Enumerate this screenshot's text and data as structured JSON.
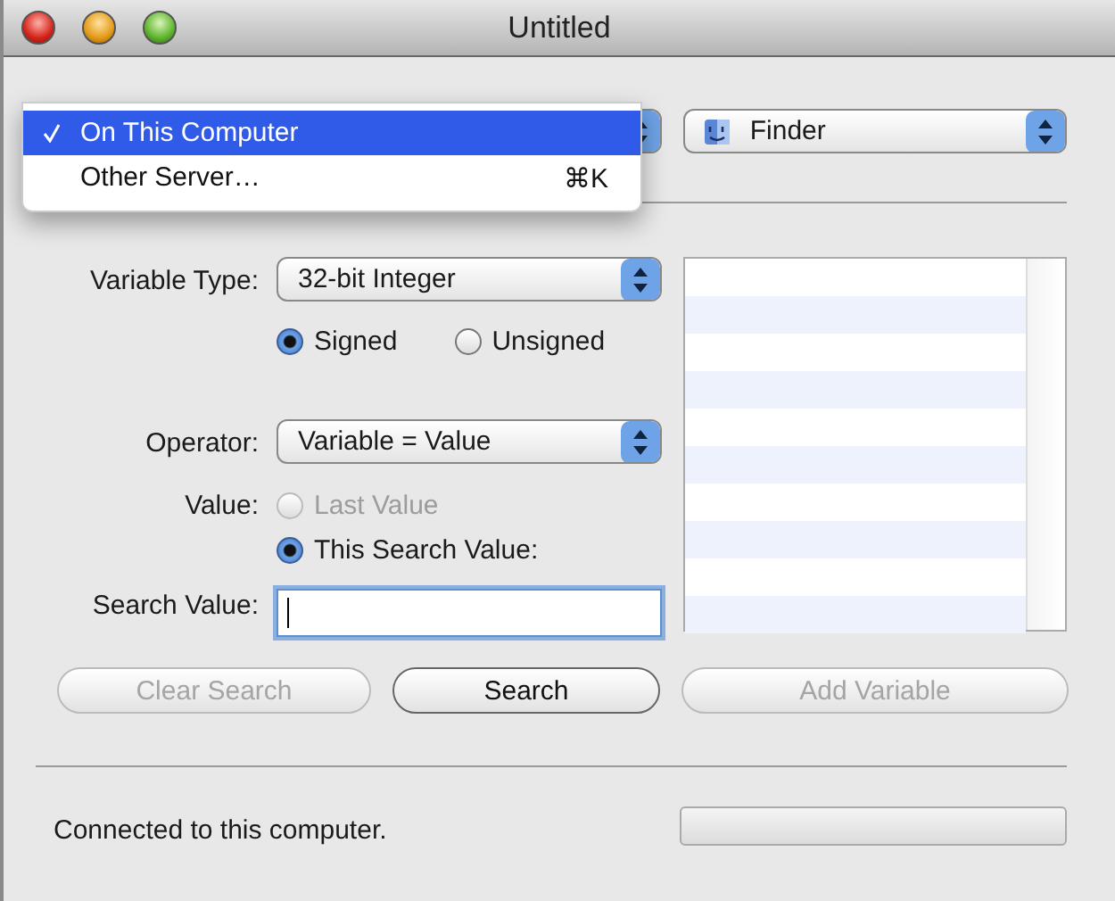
{
  "window": {
    "title": "Untitled"
  },
  "server_menu": {
    "items": [
      {
        "label": "On This Computer",
        "checked": true,
        "selected": true
      },
      {
        "label": "Other Server…",
        "shortcut": "⌘K",
        "checked": false,
        "selected": false
      }
    ]
  },
  "app_popup": {
    "value": "Finder"
  },
  "form": {
    "variable_type": {
      "label": "Variable Type:",
      "value": "32-bit Integer"
    },
    "signedness": [
      {
        "label": "Signed",
        "selected": true
      },
      {
        "label": "Unsigned",
        "selected": false
      }
    ],
    "operator": {
      "label": "Operator:",
      "value": "Variable = Value"
    },
    "value": {
      "label": "Value:",
      "options": [
        {
          "label": "Last Value",
          "selected": false,
          "disabled": true
        },
        {
          "label": "This Search Value:",
          "selected": true,
          "disabled": false
        }
      ]
    },
    "search_value": {
      "label": "Search Value:",
      "focused": true
    }
  },
  "buttons": [
    {
      "label": "Clear Search",
      "disabled": true
    },
    {
      "label": "Search",
      "disabled": false
    },
    {
      "label": "Add Variable",
      "disabled": true
    }
  ],
  "status": {
    "text": "Connected to this computer.",
    "progress": {
      "level": 0
    }
  }
}
